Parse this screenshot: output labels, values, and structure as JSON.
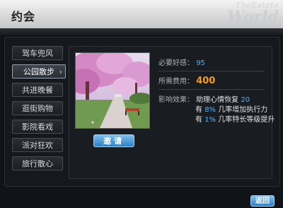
{
  "window": {
    "title": "约会",
    "watermark_line1": "TheEstate",
    "watermark_line2": "World"
  },
  "menu": {
    "items": [
      {
        "label": "驾车兜风"
      },
      {
        "label": "公园散步",
        "chevron": "›"
      },
      {
        "label": "共进晚餐"
      },
      {
        "label": "逛街购物"
      },
      {
        "label": "影院看戏"
      },
      {
        "label": "派对狂欢"
      },
      {
        "label": "旅行散心"
      }
    ],
    "selected": "公园散步"
  },
  "detail": {
    "required_favor_label": "必要好感：",
    "required_favor_value": "95",
    "cost_label": "所需费用：",
    "cost_value": "400",
    "effect_label": "影响效果：",
    "effects": [
      {
        "prefix": "助理心情恢复",
        "value": "20",
        "suffix": ""
      },
      {
        "prefix": "有",
        "value": "8%",
        "suffix": "几率增加执行力"
      },
      {
        "prefix": "有",
        "value": "1%",
        "suffix": "几率特长等级提升"
      }
    ],
    "invite_label": "邀请"
  },
  "footer": {
    "return_label": "返回"
  }
}
